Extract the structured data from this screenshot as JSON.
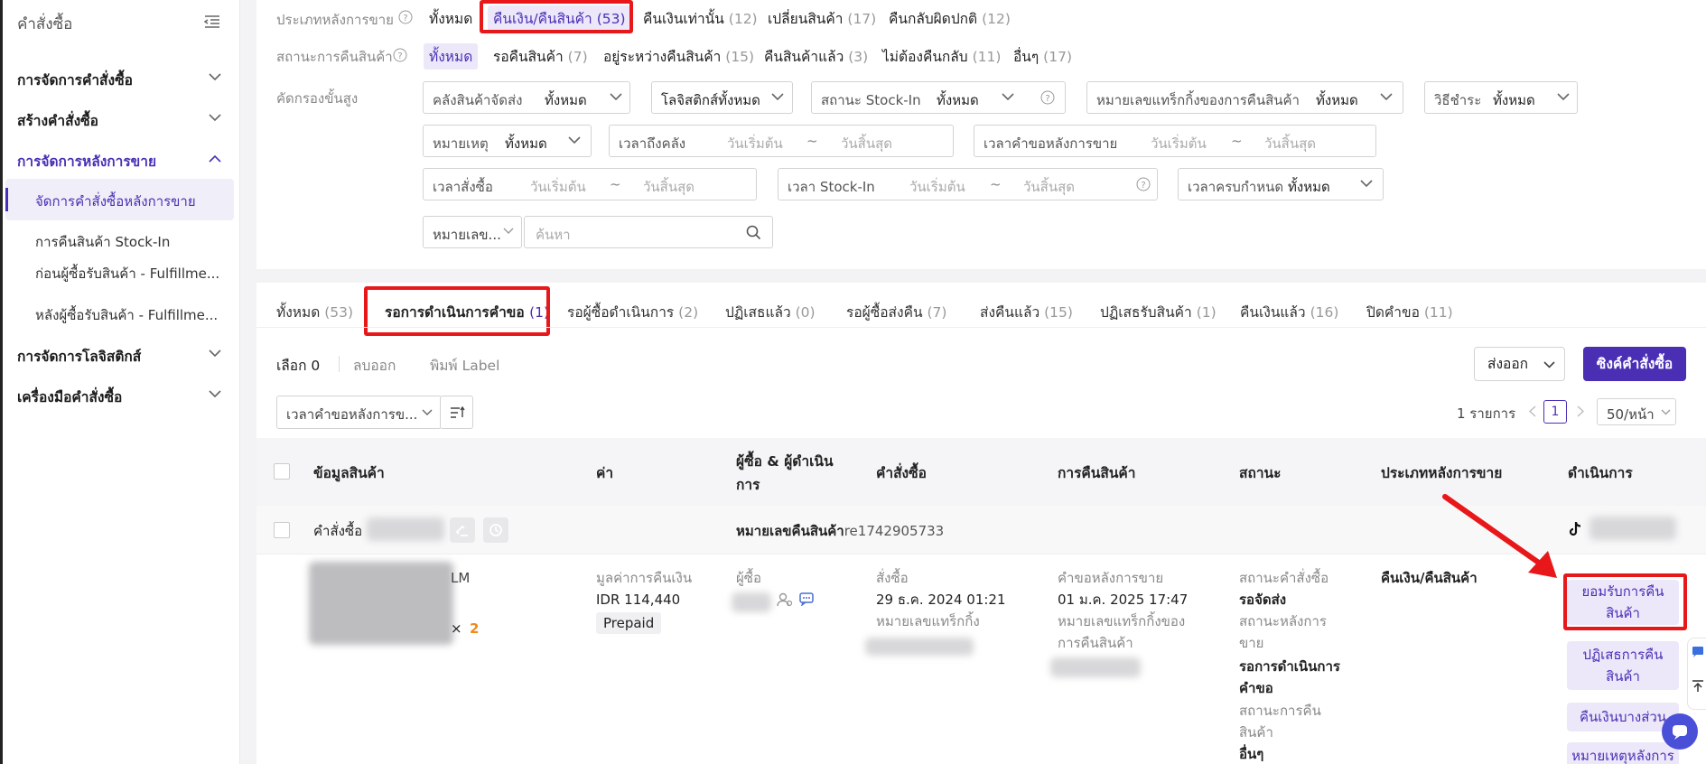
{
  "sidebar": {
    "title": "คำสั่งซื้อ",
    "sections": [
      {
        "label": "การจัดการคำสั่งซื้อ"
      },
      {
        "label": "สร้างคำสั่งซื้อ"
      },
      {
        "label": "การจัดการหลังการขาย"
      },
      {
        "label": "การจัดการโลจิสติกส์"
      },
      {
        "label": "เครื่องมือคำสั่งซื้อ"
      }
    ],
    "subitems": [
      {
        "label": "จัดการคำสั่งซื้อหลังการขาย"
      },
      {
        "label": "การคืนสินค้า Stock-In"
      },
      {
        "label": "ก่อนผู้ซื้อรับสินค้า - Fulfillme..."
      },
      {
        "label": "หลังผู้ซื้อรับสินค้า - Fulfillme..."
      }
    ]
  },
  "filters": {
    "aftersale_type": {
      "label": "ประเภทหลังการขาย",
      "options": [
        {
          "label": "ทั้งหมด",
          "count": ""
        },
        {
          "label": "คืนเงิน/คืนสินค้า",
          "count": "(53)"
        },
        {
          "label": "คืนเงินเท่านั้น",
          "count": "(12)"
        },
        {
          "label": "เปลี่ยนสินค้า",
          "count": "(17)"
        },
        {
          "label": "คืนกลับผิดปกติ",
          "count": "(12)"
        }
      ]
    },
    "return_status": {
      "label": "สถานะการคืนสินค้า",
      "options": [
        {
          "label": "ทั้งหมด",
          "count": ""
        },
        {
          "label": "รอคืนสินค้า",
          "count": "(7)"
        },
        {
          "label": "อยู่ระหว่างคืนสินค้า",
          "count": "(15)"
        },
        {
          "label": "คืนสินค้าแล้ว",
          "count": "(3)"
        },
        {
          "label": "ไม่ต้องคืนกลับ",
          "count": "(11)"
        },
        {
          "label": "อื่นๆ",
          "count": "(17)"
        }
      ]
    },
    "advanced": {
      "label": "คัดกรองขั้นสูง",
      "warehouse": {
        "label": "คลังสินค้าจัดส่ง",
        "value": "ทั้งหมด"
      },
      "logistics": {
        "label": "โลจิสติกส์ทั้งหมด"
      },
      "stockin_status": {
        "label": "สถานะ Stock-In",
        "value": "ทั้งหมด"
      },
      "tracking": {
        "label": "หมายเลขแทร็กกิ้งของการคืนสินค้า",
        "value": "ทั้งหมด"
      },
      "payment": {
        "label": "วิธีชำระ",
        "value": "ทั้งหมด"
      },
      "reason": {
        "label": "หมายเหตุ",
        "value": "ทั้งหมด"
      },
      "warehouse_time": {
        "label": "เวลาถึงคลัง",
        "start": "วันเริ่มต้น",
        "end": "วันสิ้นสุด"
      },
      "aftersale_time": {
        "label": "เวลาคำขอหลังการขาย",
        "start": "วันเริ่มต้น",
        "end": "วันสิ้นสุด"
      },
      "order_time": {
        "label": "เวลาสั่งซื้อ",
        "start": "วันเริ่มต้น",
        "end": "วันสิ้นสุด"
      },
      "stockin_time": {
        "label": "เวลา Stock-In",
        "start": "วันเริ่มต้น",
        "end": "วันสิ้นสุด"
      },
      "deadline": {
        "label": "เวลาครบกำหนด",
        "value": "ทั้งหมด"
      },
      "search_type": "หมายเลข...",
      "search_placeholder": "ค้นหา",
      "tilde": "~"
    }
  },
  "tabs": [
    {
      "label": "ทั้งหมด",
      "count": "(53)"
    },
    {
      "label": "รอการดำเนินการคำขอ",
      "count": "(1)"
    },
    {
      "label": "รอผู้ซื้อดำเนินการ",
      "count": "(2)"
    },
    {
      "label": "ปฏิเสธแล้ว",
      "count": "(0)"
    },
    {
      "label": "รอผู้ซื้อส่งคืน",
      "count": "(7)"
    },
    {
      "label": "ส่งคืนแล้ว",
      "count": "(15)"
    },
    {
      "label": "ปฏิเสธรับสินค้า",
      "count": "(1)"
    },
    {
      "label": "คืนเงินแล้ว",
      "count": "(16)"
    },
    {
      "label": "ปิดคำขอ",
      "count": "(11)"
    }
  ],
  "toolbar": {
    "selected": "เลือก 0",
    "delete": "ลบออก",
    "print": "พิมพ์ Label",
    "export": "ส่งออก",
    "sync": "ซิงค์คำสั่งซื้อ",
    "sort": "เวลาคำขอหลังการข...",
    "total": "1 รายการ",
    "page": "1",
    "per_page": "50/หน้า"
  },
  "table": {
    "headers": [
      "ข้อมูลสินค้า",
      "ค่า",
      "ผู้ซื้อ & ผู้ดำเนิน",
      "การ",
      "คำสั่งซื้อ",
      "การคืนสินค้า",
      "สถานะ",
      "ประเภทหลังการขาย",
      "ดำเนินการ"
    ],
    "order_label": "คำสั่งซื้อ",
    "return_no_label": "หมายเลขคืนสินค้า",
    "return_no": "re1742905733",
    "row": {
      "product_suffix": "LM",
      "qty_x": "×",
      "qty": "2",
      "refund_label": "มูลค่าการคืนเงิน",
      "refund_value": "IDR 114,440",
      "payment_badge": "Prepaid",
      "buyer_label": "ผู้ซื้อ",
      "order_label": "สั่งซื้อ",
      "order_time": "29 ธ.ค. 2024 01:21",
      "order_tracking_label": "หมายเลขแทร็กกิ้ง",
      "return_label": "คำขอหลังการขาย",
      "return_time": "01 ม.ค. 2025 17:47",
      "return_tracking_1": "หมายเลขแทร็กกิ้งของ",
      "return_tracking_2": "การคืนสินค้า",
      "status_order_label": "สถานะคำสั่งซื้อ",
      "status_order": "รอจัดส่ง",
      "status_aftersale_1": "สถานะหลังการ",
      "status_aftersale_2": "ขาย",
      "status_aftersale_v1": "รอการดำเนินการ",
      "status_aftersale_v2": "คำขอ",
      "status_return_1": "สถานะการคืน",
      "status_return_2": "สินค้า",
      "status_return": "อื่นๆ",
      "type": "คืนเงิน/คืนสินค้า",
      "actions": {
        "accept_1": "ยอมรับการคืน",
        "accept_2": "สินค้า",
        "reject_1": "ปฏิเสธการคืน",
        "reject_2": "สินค้า",
        "partial": "คืนเงินบางส่วน",
        "note": "หมายเหตุหลังการ"
      }
    }
  },
  "colors": {
    "accent": "#4a2fb5",
    "highlight": "#e8181a"
  }
}
